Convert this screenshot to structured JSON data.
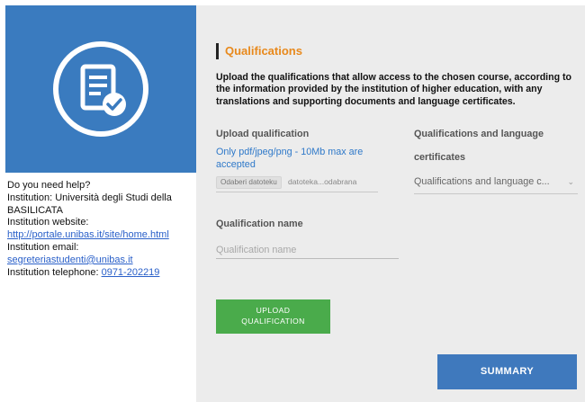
{
  "icons": {
    "logo": "document-check-icon",
    "dropdown": "chevron-down-icon"
  },
  "colors": {
    "logo_bg": "#3a7bbf",
    "accent_title": "#e8891c",
    "link": "#2a60c9",
    "upload_button": "#4aab4b",
    "summary_button": "#3f79bd"
  },
  "help": {
    "question": "Do you need help?",
    "institution_line1": "Institution: Università degli Studi della",
    "institution_line2": "BASILICATA",
    "website_label": "Institution website:",
    "website_url": "http://portale.unibas.it/site/home.html",
    "email_label": "Institution email:",
    "email": "segreteriastudenti@unibas.it",
    "telephone_label": "Institution telephone: ",
    "telephone": "0971-202219"
  },
  "main": {
    "section_title": "Qualifications",
    "intro": "Upload the qualifications that allow access to the chosen course, according to the information provided by the institution of higher education, with any translations and supporting documents and language certificates.",
    "upload_label": "Upload qualification",
    "upload_hint": "Only pdf/jpeg/png - 10Mb max are accepted",
    "file_button": "Odaberi datoteku",
    "file_status": "datoteka...odabrana",
    "certs_label_line1": "Qualifications and language",
    "certs_label_line2": "certificates",
    "certs_selected": "Qualifications and language c...",
    "name_label": "Qualification name",
    "name_placeholder": "Qualification name",
    "upload_button_line1": "UPLOAD",
    "upload_button_line2": "QUALIFICATION",
    "summary_button": "SUMMARY"
  }
}
